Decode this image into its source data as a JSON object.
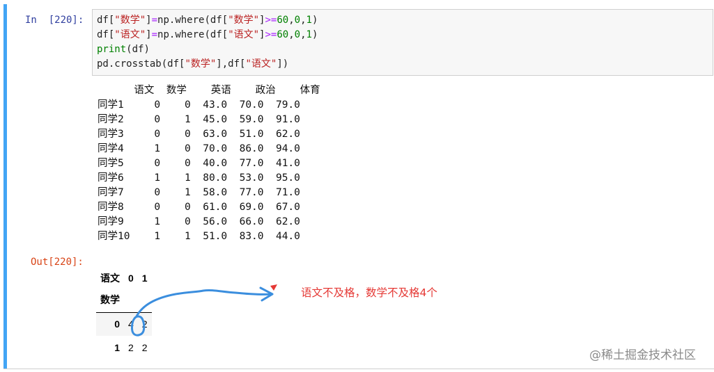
{
  "input_prompt": "In  [220]:",
  "output_prompt": "Out[220]:",
  "code": {
    "line1": {
      "a": "df[",
      "s1": "\"数学\"",
      "b": "]",
      "op1": "=",
      "c": "np.where(df[",
      "s2": "\"数学\"",
      "d": "]",
      "op2": ">=",
      "n1": "60",
      "e": ",",
      "n2": "0",
      "f": ",",
      "n3": "1",
      "g": ")"
    },
    "line2": {
      "a": "df[",
      "s1": "\"语文\"",
      "b": "]",
      "op1": "=",
      "c": "np.where(df[",
      "s2": "\"语文\"",
      "d": "]",
      "op2": ">=",
      "n1": "60",
      "e": ",",
      "n2": "0",
      "f": ",",
      "n3": "1",
      "g": ")"
    },
    "line3": {
      "kw": "print",
      "rest": "(df)"
    },
    "line4": {
      "a": "pd.crosstab(df[",
      "s1": "\"数学\"",
      "b": "],df[",
      "s2": "\"语文\"",
      "c": "])"
    }
  },
  "stdout": {
    "header": "      语文  数学    英语    政治    体育",
    "rows": [
      "同学1     0    0  43.0  70.0  79.0",
      "同学2     0    1  45.0  59.0  91.0",
      "同学3     0    0  63.0  51.0  62.0",
      "同学4     1    0  70.0  86.0  94.0",
      "同学5     0    0  40.0  77.0  41.0",
      "同学6     1    1  80.0  53.0  95.0",
      "同学7     0    1  58.0  77.0  71.0",
      "同学8     0    0  61.0  69.0  67.0",
      "同学9     1    0  56.0  66.0  62.0",
      "同学10    1    1  51.0  83.0  44.0"
    ]
  },
  "crosstab": {
    "col_axis_name": "语文",
    "columns": [
      "0",
      "1"
    ],
    "row_axis_name": "数学",
    "rows": [
      {
        "index": "0",
        "values": [
          "4",
          "2"
        ]
      },
      {
        "index": "1",
        "values": [
          "2",
          "2"
        ]
      }
    ]
  },
  "annotation": {
    "text": "语文不及格，数学不及格4个",
    "color": "#e53935",
    "pen_color": "#3b8ede"
  },
  "watermark": "@稀土掘金技术社区",
  "colors": {
    "cell_bar": "#42a5f5",
    "prompt_in": "#303f9f",
    "prompt_out": "#d84315"
  }
}
